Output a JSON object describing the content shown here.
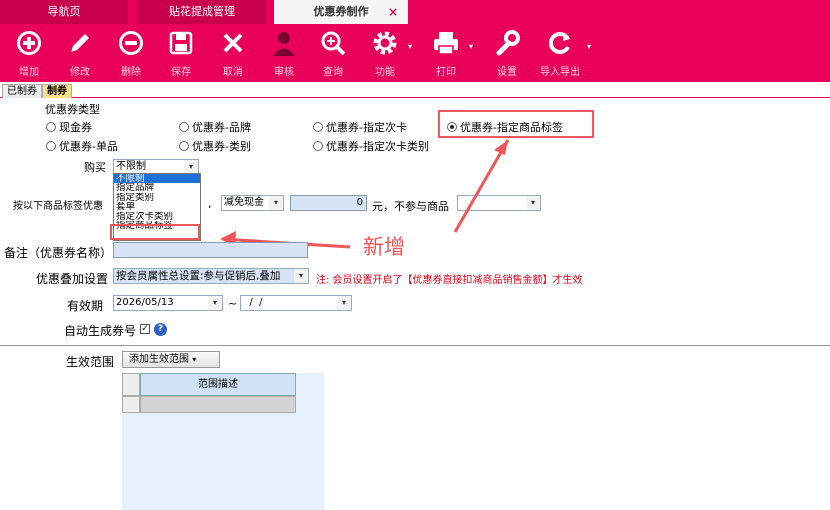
{
  "tabs": [
    {
      "label": "导航页"
    },
    {
      "label": "贴花提成管理"
    },
    {
      "label": "优惠券制作",
      "close": "×"
    }
  ],
  "toolbar": [
    {
      "label": "增加",
      "icon": "plus-circle-icon"
    },
    {
      "label": "修改",
      "icon": "pencil-icon"
    },
    {
      "label": "删除",
      "icon": "minus-circle-icon"
    },
    {
      "label": "保存",
      "icon": "floppy-disk-icon"
    },
    {
      "label": "取消",
      "icon": "x-icon"
    },
    {
      "label": "审核",
      "icon": "user-icon"
    },
    {
      "label": "查询",
      "icon": "magnifier-icon"
    },
    {
      "label": "功能",
      "icon": "gear-icon"
    },
    {
      "label": "打印",
      "icon": "printer-icon"
    },
    {
      "label": "设置",
      "icon": "wrench-icon"
    },
    {
      "label": "导入导出",
      "icon": "refresh-icon"
    }
  ],
  "subtabs": [
    {
      "label": "已制券"
    },
    {
      "label": "制券"
    }
  ],
  "coupon_type": {
    "title": "优惠券类型",
    "options": [
      {
        "label": "现金券",
        "checked": false
      },
      {
        "label": "优惠券-品牌",
        "checked": false
      },
      {
        "label": "优惠券-指定次卡",
        "checked": false
      },
      {
        "label": "优惠券-指定商品标签",
        "checked": true
      },
      {
        "label": "优惠券-单品",
        "checked": false
      },
      {
        "label": "优惠券-类别",
        "checked": false
      },
      {
        "label": "优惠券-指定次卡类别",
        "checked": false
      }
    ]
  },
  "purchase": {
    "label": "购买",
    "value": "不限制",
    "dropdown_options": [
      "不限制",
      "指定品牌",
      "指定类别",
      "套单",
      "指定次卡类别",
      "指定商品标签"
    ],
    "dropdown_selected_index": 0
  },
  "discount_row": {
    "label": "按以下商品标签优惠",
    "comma": ",",
    "mode_value": "减免现金",
    "amount": "0",
    "suffix": "元，不参与商品"
  },
  "remark": {
    "label": "备注（优惠券名称）"
  },
  "stack": {
    "label": "优惠叠加设置",
    "value": "按会员属性总设置:参与促销后,叠加",
    "note": "注: 会员设置开启了【优惠券直接扣减商品销售金额】才生效"
  },
  "validity": {
    "label": "有效期",
    "start": "2026/05/13",
    "tilde": "~",
    "end": "  /  /"
  },
  "auto_gen": {
    "label": "自动生成券号",
    "check": "✓",
    "help": "?"
  },
  "annotation": "新增",
  "scope": {
    "label": "生效范围",
    "button": "添加生效范围",
    "column": "范围描述"
  },
  "colors": {
    "brand": "#e8005a",
    "annotation": "#f0565a",
    "note": "#e0001a"
  }
}
